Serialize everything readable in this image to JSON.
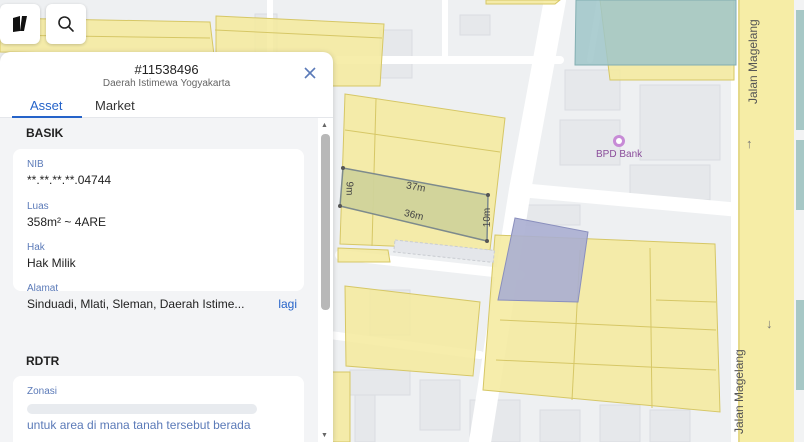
{
  "app": {
    "logo_icon": "brand-logo-icon",
    "search_icon": "search-icon"
  },
  "map": {
    "poi": {
      "name": "BPD Bank",
      "icon": "bank-icon"
    },
    "roads": [
      {
        "name": "Jalan Magelang"
      },
      {
        "name": "Jalan Magelang"
      }
    ],
    "measurements": {
      "top": "37m",
      "bottom": "36m",
      "left": "9m",
      "right": "10m"
    },
    "colors": {
      "parcel": "#f4ea9c",
      "selected": "#d0d39a",
      "teal": "#9fc6c9",
      "purple": "#aaaed2",
      "road": "#ffffff"
    }
  },
  "panel": {
    "id": "#11538496",
    "region": "Daerah Istimewa Yogyakarta",
    "tabs": [
      {
        "label": "Asset",
        "active": true
      },
      {
        "label": "Market",
        "active": false
      }
    ],
    "basik": {
      "title": "BASIK",
      "fields": [
        {
          "label": "NIB",
          "value": "**.**.**.**.04744"
        },
        {
          "label": "Luas",
          "value": "358m² ~ 4ARE"
        },
        {
          "label": "Hak",
          "value": "Hak Milik"
        },
        {
          "label": "Alamat",
          "value": "Sinduadi, Mlati, Sleman, Daerah Istime...",
          "more": "lagi"
        }
      ]
    },
    "rdtr": {
      "title": "RDTR",
      "zonasi_label": "Zonasi",
      "zonasi_desc": "untuk area di mana tanah tersebut berada"
    }
  }
}
